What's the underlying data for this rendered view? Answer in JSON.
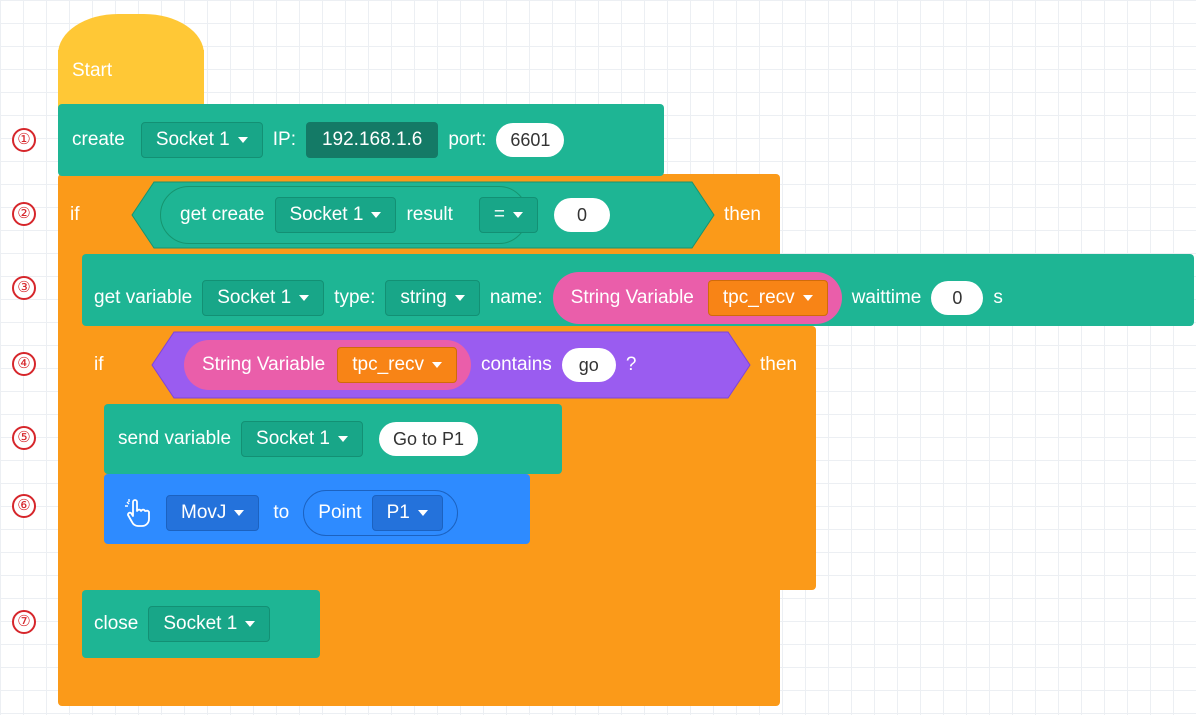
{
  "start_label": "Start",
  "step_markers": [
    "①",
    "②",
    "③",
    "④",
    "⑤",
    "⑥",
    "⑦"
  ],
  "create_block": {
    "label": "create",
    "socket": "Socket 1",
    "ip_label": "IP:",
    "ip_value": "192.168.1.6",
    "port_label": "port:",
    "port_value": "6601"
  },
  "if_outer": {
    "if_label": "if",
    "get_create_label": "get create",
    "socket": "Socket 1",
    "result_label": "result",
    "operator": "=",
    "compare_value": "0",
    "then_label": "then"
  },
  "get_variable": {
    "label": "get variable",
    "socket": "Socket 1",
    "type_label": "type:",
    "type_value": "string",
    "name_label": "name:",
    "var_kind": "String Variable",
    "var_name": "tpc_recv",
    "waittime_label": "waittime",
    "waittime_value": "0",
    "unit": "s"
  },
  "if_inner": {
    "if_label": "if",
    "var_kind": "String Variable",
    "var_name": "tpc_recv",
    "contains_label": "contains",
    "contains_value": "go",
    "question": "?",
    "then_label": "then"
  },
  "send_variable": {
    "label": "send variable",
    "socket": "Socket 1",
    "value": "Go to P1"
  },
  "movj": {
    "icon": "pointer-hand-icon",
    "motion": "MovJ",
    "to_label": "to",
    "point_label": "Point",
    "point_value": "P1"
  },
  "close_block": {
    "label": "close",
    "socket": "Socket 1"
  },
  "colors": {
    "teal": "#1eb594",
    "orange": "#fb9a19",
    "blue": "#2e8bff",
    "purple": "#9a5cf0",
    "pink": "#ea5eaa",
    "yellow": "#ffc836",
    "marker_red": "#d6262b"
  }
}
